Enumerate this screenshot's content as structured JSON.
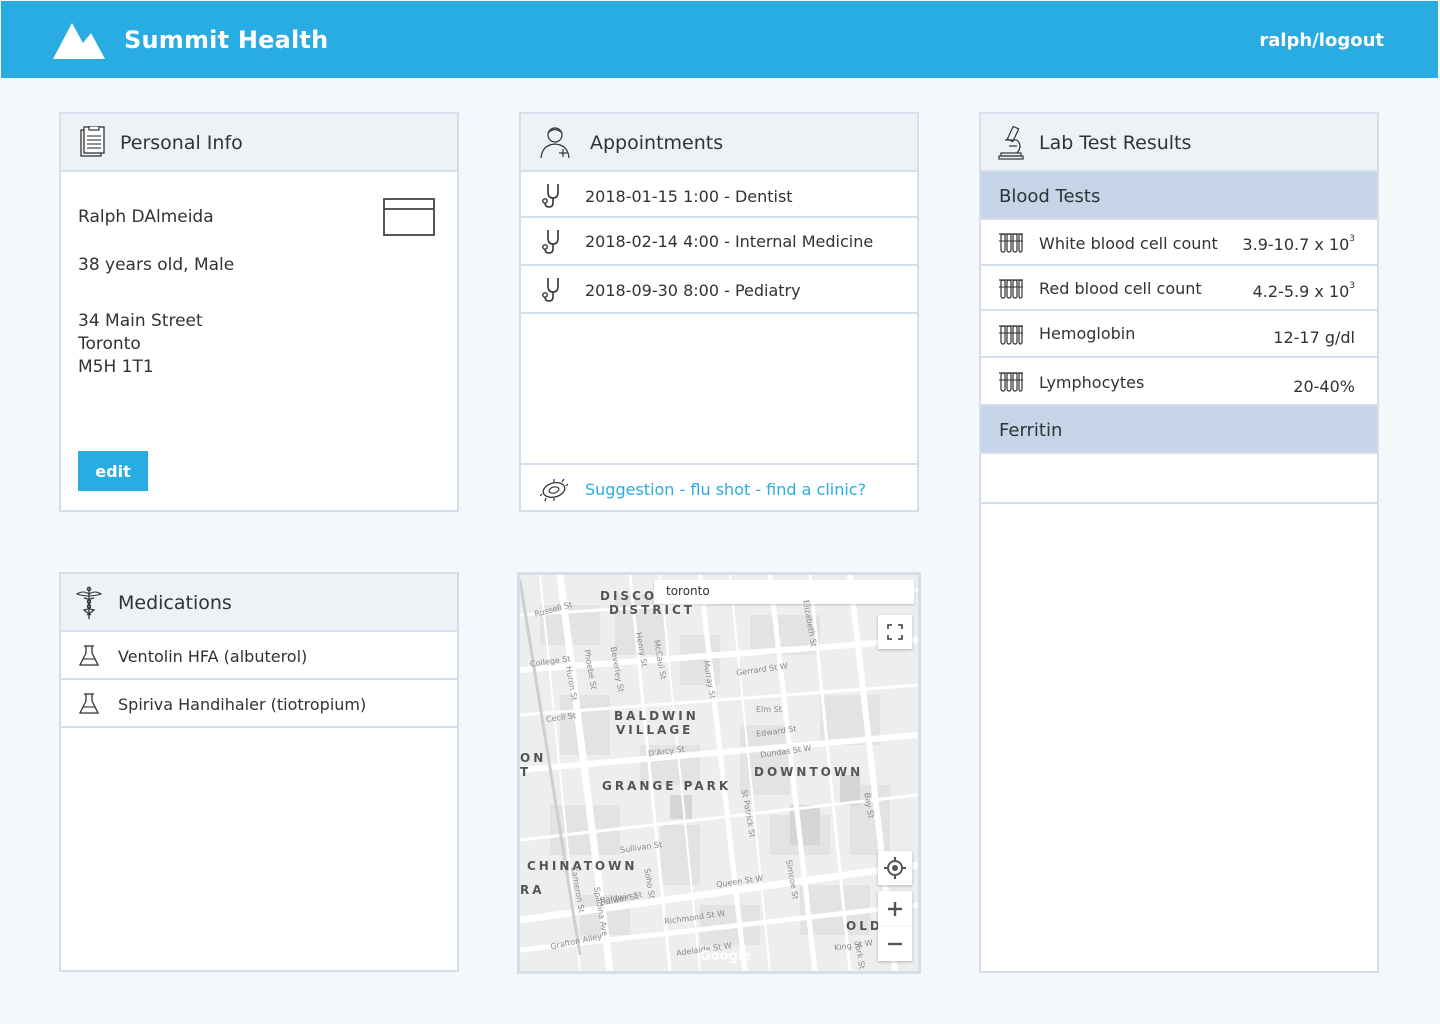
{
  "header": {
    "brand": "Summit Health",
    "user_link": "ralph/logout"
  },
  "personal_info": {
    "title": "Personal Info",
    "name": "Ralph DAlmeida",
    "age_sex": "38 years old, Male",
    "address_line1": "34 Main Street",
    "address_line2": "Toronto",
    "address_line3": "M5H 1T1",
    "edit_label": "edit"
  },
  "appointments": {
    "title": "Appointments",
    "items": [
      {
        "text": "2018-01-15 1:00 - Dentist"
      },
      {
        "text": "2018-02-14 4:00 - Internal Medicine"
      },
      {
        "text": "2018-09-30 8:00 - Pediatry"
      }
    ],
    "suggestion": "Suggestion - flu shot - find a clinic?"
  },
  "lab_results": {
    "title": "Lab Test Results",
    "sections": [
      {
        "name": "Blood Tests",
        "tests": [
          {
            "name": "White blood cell count",
            "value": "3.9-10.7 x 10",
            "sup": "3"
          },
          {
            "name": "Red blood cell count",
            "value": "4.2-5.9 x 10",
            "sup": "3"
          },
          {
            "name": "Hemoglobin",
            "value": "12-17 g/dl",
            "sup": ""
          },
          {
            "name": "Lymphocytes",
            "value": "20-40%",
            "sup": ""
          }
        ]
      },
      {
        "name": "Ferritin",
        "tests": []
      }
    ]
  },
  "medications": {
    "title": "Medications",
    "items": [
      {
        "name": "Ventolin HFA (albuterol)"
      },
      {
        "name": "Spiriva Handihaler (tiotropium)"
      }
    ]
  },
  "map": {
    "search_value": "toronto",
    "areas": [
      "DISCO",
      "DISTRICT",
      "BALDWIN",
      "VILLAGE",
      "GRANGE PARK",
      "DOWNTOWN",
      "CHINATOWN",
      "ON",
      "T",
      "RA",
      "OLD"
    ],
    "streets": [
      "College St",
      "Gerrard St W",
      "Elm St",
      "Edward St",
      "Dundas St W",
      "Beverley St",
      "McCaul St",
      "Murray St",
      "Queen St W",
      "Richmond St W",
      "Adelaide St W",
      "King St W",
      "Spadina Ave",
      "Bay St",
      "Soho St",
      "Cecil St",
      "Baldwin St",
      "D'Arcy St",
      "Sullivan St",
      "Huron St",
      "Russell St",
      "Elizabeth St",
      "Simcoe St",
      "St Patrick St",
      "Henry St",
      "Phoebe St",
      "Cameron St",
      "Grafton Alley",
      "Bulwer St",
      "York St"
    ],
    "attribution": "Google"
  },
  "colors": {
    "brand": "#29ace2",
    "background": "#f5f8fb",
    "card_border": "#d5dfec",
    "section_bg": "#c5d4e6"
  }
}
